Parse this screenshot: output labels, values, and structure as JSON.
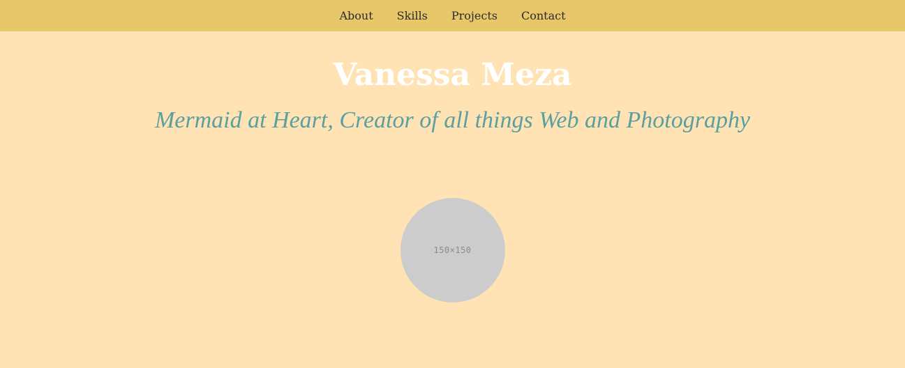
{
  "nav": {
    "items": [
      {
        "label": "About"
      },
      {
        "label": "Skills"
      },
      {
        "label": "Projects"
      },
      {
        "label": "Contact"
      }
    ]
  },
  "hero": {
    "name": "Vanessa Meza",
    "tagline": "Mermaid at Heart, Creator of all things Web and Photography",
    "avatar_placeholder": "150×150"
  },
  "colors": {
    "nav_background": "#e8c76a",
    "page_background": "#ffe3b5",
    "name_color": "#ffffff",
    "tagline_color": "#5b9fa0",
    "avatar_placeholder": "#cccccc"
  }
}
